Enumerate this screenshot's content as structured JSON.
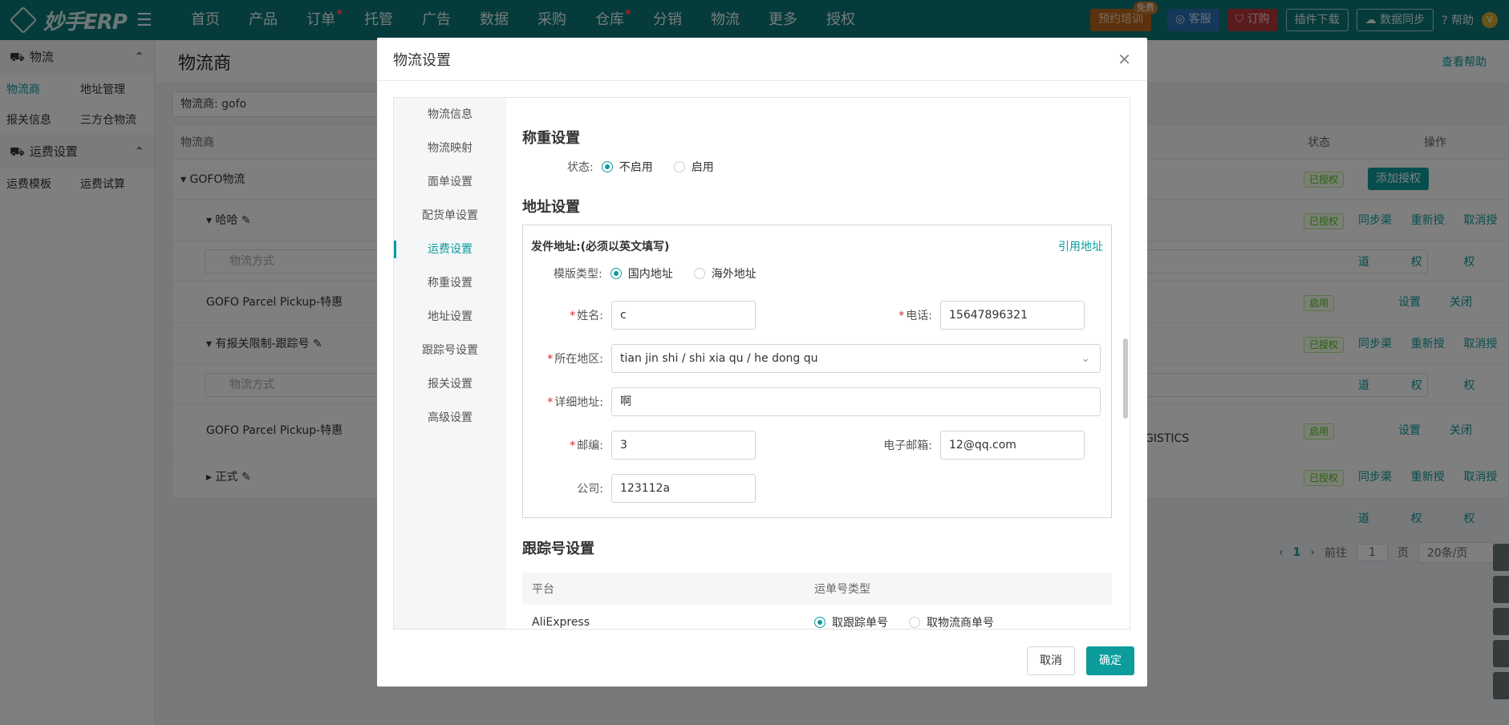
{
  "app": {
    "logo_text": "妙手ERP",
    "nav": [
      {
        "label": "首页",
        "dot": false
      },
      {
        "label": "产品",
        "dot": false
      },
      {
        "label": "订单",
        "dot": true
      },
      {
        "label": "托管",
        "dot": false
      },
      {
        "label": "广告",
        "dot": false
      },
      {
        "label": "数据",
        "dot": false
      },
      {
        "label": "采购",
        "dot": false
      },
      {
        "label": "仓库",
        "dot": true
      },
      {
        "label": "分销",
        "dot": false
      },
      {
        "label": "物流",
        "dot": false
      },
      {
        "label": "更多",
        "dot": false
      },
      {
        "label": "授权",
        "dot": false
      }
    ],
    "top_right": {
      "training": "预约培训",
      "free_badge": "免费",
      "service": "客服",
      "order": "订购",
      "plugin": "插件下载",
      "sync": "数据同步",
      "help": "帮助",
      "avatar": "V"
    }
  },
  "sidebar": {
    "groups": [
      {
        "label": "物流",
        "icon": "truck-icon",
        "links": [
          [
            "物流商",
            "地址管理"
          ],
          [
            "报关信息",
            "三方仓物流"
          ]
        ]
      },
      {
        "label": "运费设置",
        "icon": "truck-icon",
        "links": [
          [
            "运费模板",
            "运费试算"
          ]
        ]
      }
    ],
    "active": "物流商"
  },
  "page": {
    "title": "物流商",
    "help_link": "查看帮助",
    "filter_label": "物流商:",
    "filter_value": "gofo",
    "table_headers": {
      "carrier": "物流商",
      "status": "状态",
      "ops": "操作"
    },
    "rows": {
      "gofo": "GOFO物流",
      "haha": "哈哈",
      "search_placeholder": "物流方式",
      "pickup1": "GOFO Parcel Pickup-特惠",
      "restricted": "有报关限制-跟踪号",
      "pickup2": "GOFO Parcel Pickup-特惠",
      "formal": "正式",
      "logistics_suffix": "GISTICS"
    },
    "status": {
      "authorized": "已授权",
      "enabled": "启用"
    },
    "actions": {
      "add_auth": "添加授权",
      "sync": "同步渠道",
      "reauth": "重新授权",
      "cancel_auth": "取消授权",
      "setting": "设置",
      "close": "关闭"
    },
    "pager": {
      "current": "1",
      "goto": "前往",
      "page_input": "1",
      "page_unit": "页",
      "size": "20条/页"
    }
  },
  "modal": {
    "title": "物流设置",
    "nav": [
      "物流信息",
      "物流映射",
      "面单设置",
      "配货单设置",
      "运费设置",
      "称重设置",
      "地址设置",
      "跟踪号设置",
      "报关设置",
      "高级设置"
    ],
    "active_nav": "运费设置",
    "weigh": {
      "title": "称重设置",
      "status_label": "状态:",
      "opt_off": "不启用",
      "opt_on": "启用"
    },
    "address": {
      "title": "地址设置",
      "sender_title": "发件地址:(必须以英文填写)",
      "quote_link": "引用地址",
      "template_label": "模版类型:",
      "domestic": "国内地址",
      "overseas": "海外地址",
      "name_label": "姓名:",
      "name_value": "c",
      "phone_label": "电话:",
      "phone_value": "15647896321",
      "region_label": "所在地区:",
      "region_value": "tian jin shi / shi xia qu / he dong qu",
      "detail_label": "详细地址:",
      "detail_value": "啊",
      "zip_label": "邮编:",
      "zip_value": "3",
      "email_label": "电子邮箱:",
      "email_value": "12@qq.com",
      "company_label": "公司:",
      "company_value": "123112a"
    },
    "tracking": {
      "title": "跟踪号设置",
      "col_platform": "平台",
      "col_type": "运单号类型",
      "row_platform": "AliExpress",
      "opt_track": "取跟踪单号",
      "opt_carrier": "取物流商单号"
    },
    "cancel": "取消",
    "confirm": "确定"
  }
}
